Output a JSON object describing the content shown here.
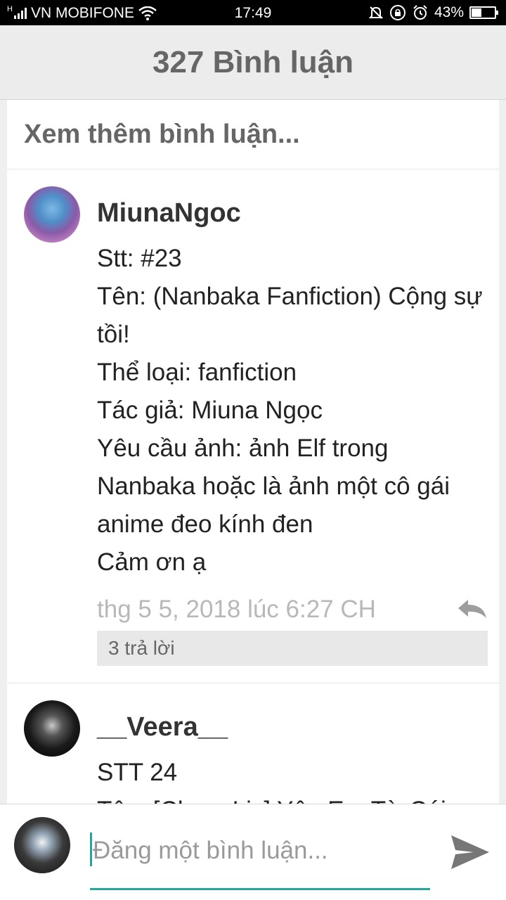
{
  "status_bar": {
    "carrier": "VN MOBIFONE",
    "network": "H",
    "time": "17:49",
    "battery_percent": "43%",
    "battery_level": 0.43
  },
  "header": {
    "title": "327 Bình luận"
  },
  "comments_section": {
    "load_more_label": "Xem thêm bình luận...",
    "comments": [
      {
        "username": "MiunaNgoc",
        "lines": [
          "Stt:  #23",
          "Tên: (Nanbaka Fanfiction) Cộng sự tồi!",
          "Thể loại:  fanfiction",
          "Tác giả:  Miuna Ngọc",
          "Yêu cầu ảnh:  ảnh Elf trong Nanbaka hoặc là ảnh một cô gái anime đeo kính đen",
          "Cảm ơn ạ"
        ],
        "timestamp": "thg 5 5, 2018 lúc 6:27 CH",
        "replies_label": "3 trả lời"
      },
      {
        "username": "__Veera__",
        "lines": [
          "STT 24",
          "Tên: [ChangLix] Yêu Em Từ Cái"
        ]
      }
    ]
  },
  "composer": {
    "placeholder": "Đăng một bình luận...",
    "value": ""
  },
  "colors": {
    "accent": "#26a69a",
    "header_text": "#666666",
    "timestamp": "#b8b8b8"
  },
  "icons": [
    "wifi-icon",
    "mute-icon",
    "rotation-lock-icon",
    "alarm-icon",
    "battery-icon",
    "reply-icon",
    "send-icon"
  ]
}
